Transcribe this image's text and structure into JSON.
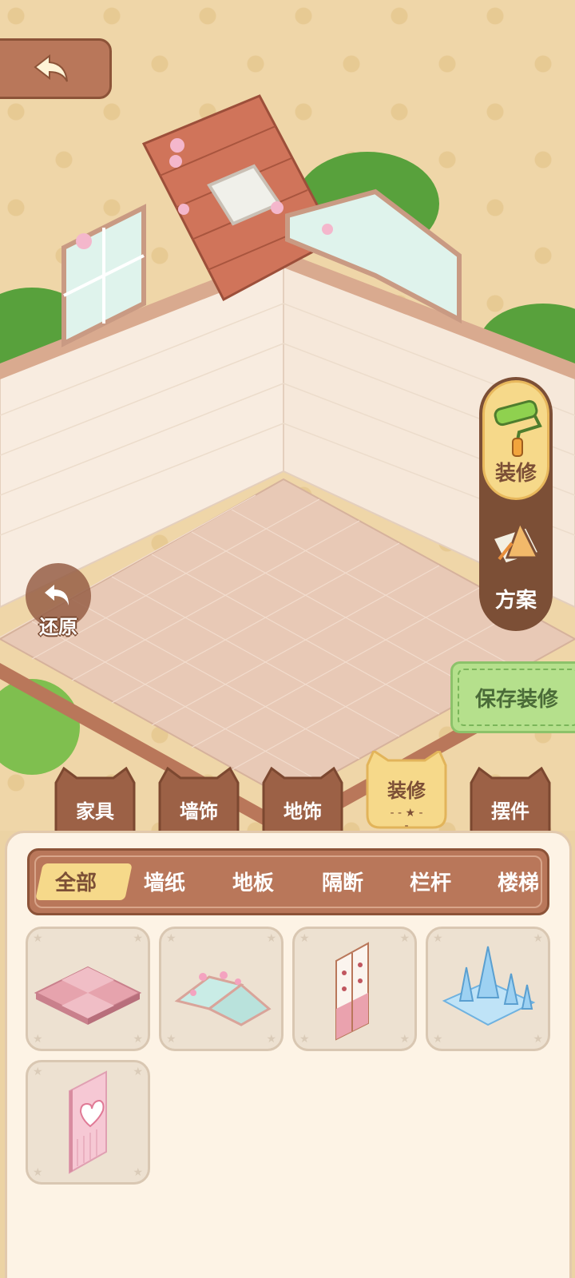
{
  "sidebar": {
    "decorate_label": "装修",
    "plan_label": "方案"
  },
  "restore_label": "还原",
  "save_label": "保存装修",
  "categories": [
    {
      "label": "家具"
    },
    {
      "label": "墙饰"
    },
    {
      "label": "地饰"
    },
    {
      "label": "装修",
      "active": true
    },
    {
      "label": "摆件"
    }
  ],
  "subtabs": [
    {
      "label": "全部",
      "active": true
    },
    {
      "label": "墙纸"
    },
    {
      "label": "地板"
    },
    {
      "label": "隔断"
    },
    {
      "label": "栏杆"
    },
    {
      "label": "楼梯"
    }
  ],
  "items": [
    {
      "name": "pink-floor-tile"
    },
    {
      "name": "rose-glass-greenhouse-roof"
    },
    {
      "name": "floral-curtain-partition"
    },
    {
      "name": "ice-castle"
    },
    {
      "name": "pink-heart-door"
    }
  ],
  "colors": {
    "panel_brown": "#b9775a",
    "active_yellow": "#f6d98a",
    "save_green": "#b5e08c",
    "panel_cream": "#fdf3e5"
  }
}
